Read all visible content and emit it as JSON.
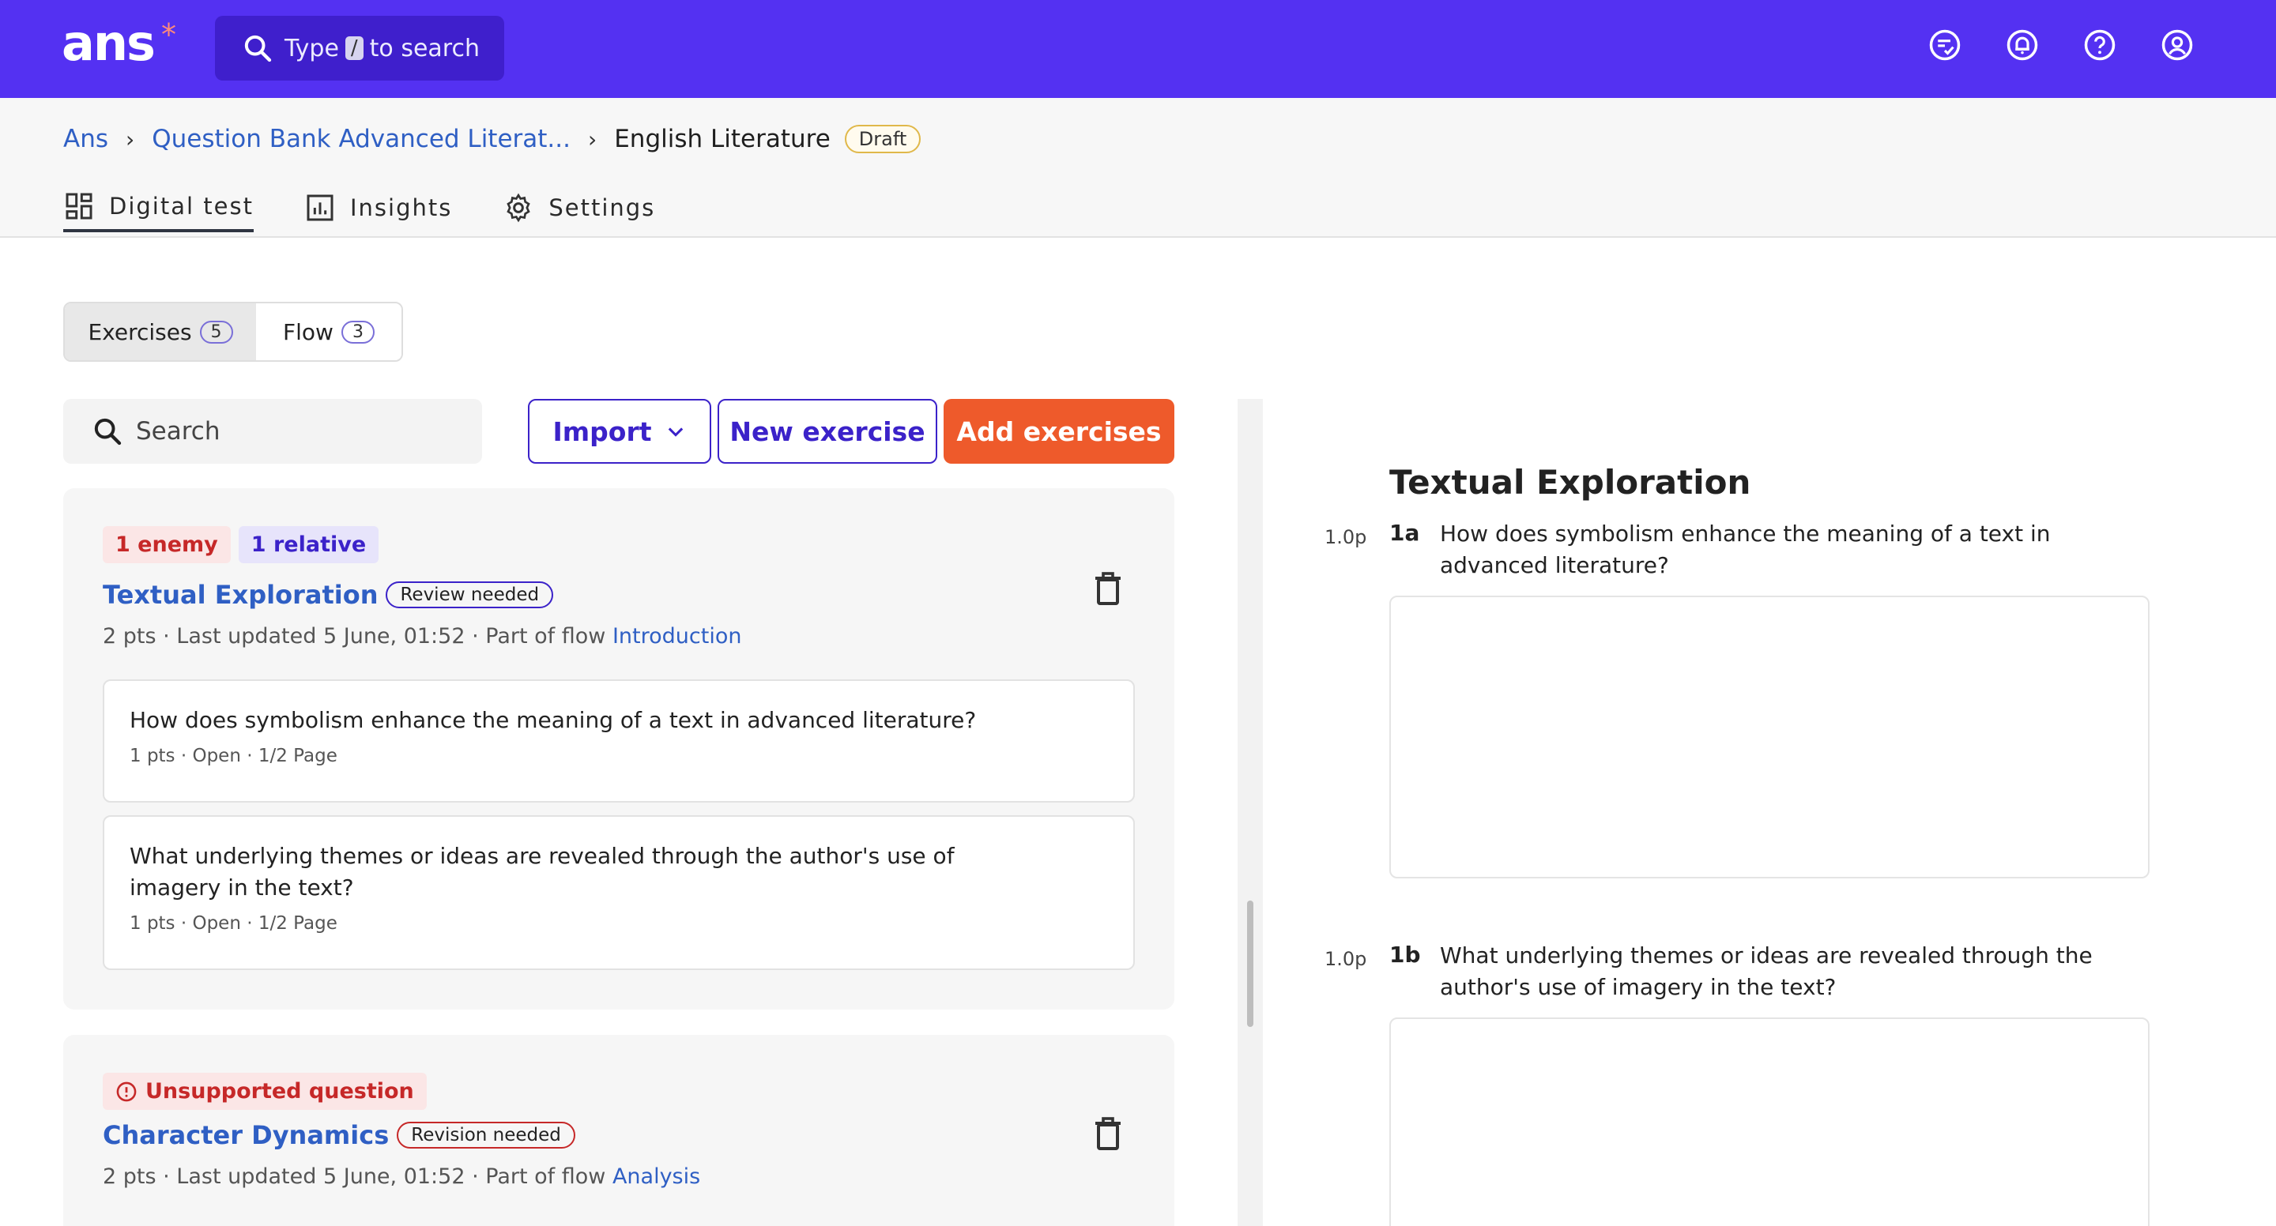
{
  "app": {
    "logo_text": "ans",
    "logo_mark": "*",
    "search": {
      "prefix": "Type",
      "key": "/",
      "suffix": "to search"
    },
    "top_icons": [
      "chat-check-icon",
      "bell-icon",
      "help-icon",
      "account-icon"
    ]
  },
  "breadcrumb": {
    "root": "Ans",
    "parent": "Question Bank Advanced Literat...",
    "current": "English Literature",
    "badge": "Draft"
  },
  "tabs": [
    {
      "label": "Digital test",
      "icon": "dashboard-icon",
      "active": true
    },
    {
      "label": "Insights",
      "icon": "chart-icon",
      "active": false
    },
    {
      "label": "Settings",
      "icon": "gear-icon",
      "active": false
    }
  ],
  "toggle": {
    "exercises": {
      "label": "Exercises",
      "count": "5"
    },
    "flow": {
      "label": "Flow",
      "count": "3"
    }
  },
  "actions": {
    "search_placeholder": "Search",
    "import_label": "Import",
    "new_label": "New exercise",
    "add_label": "Add exercises"
  },
  "exercises": [
    {
      "tags": [
        "1 enemy",
        "1 relative"
      ],
      "title": "Textual Exploration",
      "status": "Review needed",
      "meta": "2 pts · Last updated 5 June, 01:52 · Part of flow",
      "flow": "Introduction",
      "questions": [
        {
          "text": "How does symbolism enhance the meaning of a text in advanced literature?",
          "meta": "1 pts · Open · 1/2 Page"
        },
        {
          "text": "What underlying themes or ideas are revealed through the author's use of imagery in the text?",
          "meta": "1 pts · Open · 1/2 Page"
        }
      ]
    },
    {
      "tags": [
        "Unsupported question"
      ],
      "title": "Character Dynamics",
      "status": "Revision needed",
      "meta": "2 pts · Last updated 5 June, 01:52 · Part of flow",
      "flow": "Analysis"
    }
  ],
  "preview": {
    "title": "Textual Exploration",
    "questions": [
      {
        "points": "1.0p",
        "number": "1a",
        "text": "How does symbolism enhance the meaning of a text in advanced literature?"
      },
      {
        "points": "1.0p",
        "number": "1b",
        "text": "What underlying themes or ideas are revealed through the author's use of imagery in the text?"
      }
    ]
  },
  "colors": {
    "brand": "#5431f2",
    "accent_button": "#ee5a2b",
    "link": "#2f5fc4",
    "danger": "#c62828"
  }
}
